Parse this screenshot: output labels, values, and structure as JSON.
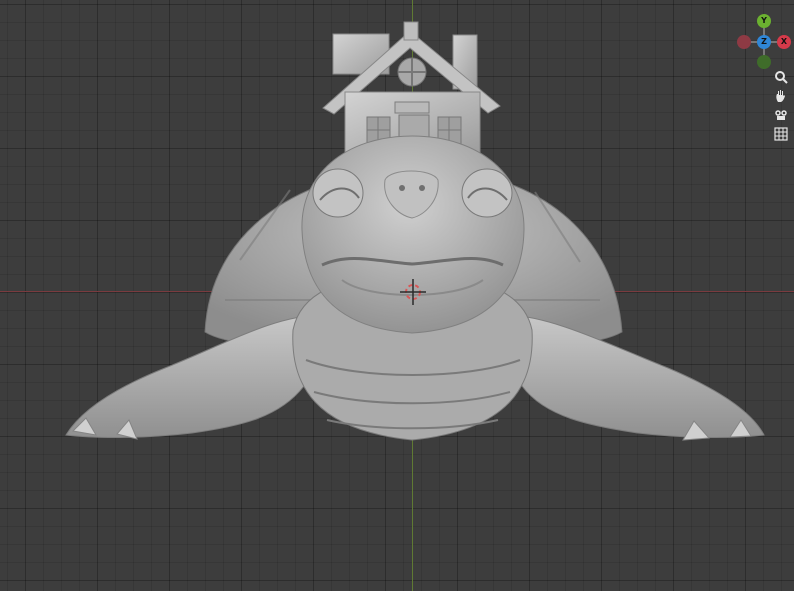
{
  "viewport": {
    "background": "#3d3d3d",
    "x_axis_color": "#7a3b3f",
    "z_axis_color": "#5f7a33",
    "model": "turtle-with-house-sculpt",
    "model_color": "#b5b5b5"
  },
  "gizmo": {
    "y_label": "Y",
    "z_label": "Z",
    "x_label": "X",
    "y_color": "#6bb130",
    "z_color": "#2f86d6",
    "x_color": "#d63a4a",
    "neg_x_color": "#8e3a44",
    "neg_y_color": "#3f6c2a"
  },
  "nav_tools": [
    {
      "name": "zoom-icon",
      "glyph": "🔍"
    },
    {
      "name": "pan-hand-icon",
      "glyph": "✋"
    },
    {
      "name": "camera-icon",
      "glyph": "🎥"
    },
    {
      "name": "perspective-grid-icon",
      "glyph": "▦"
    }
  ]
}
